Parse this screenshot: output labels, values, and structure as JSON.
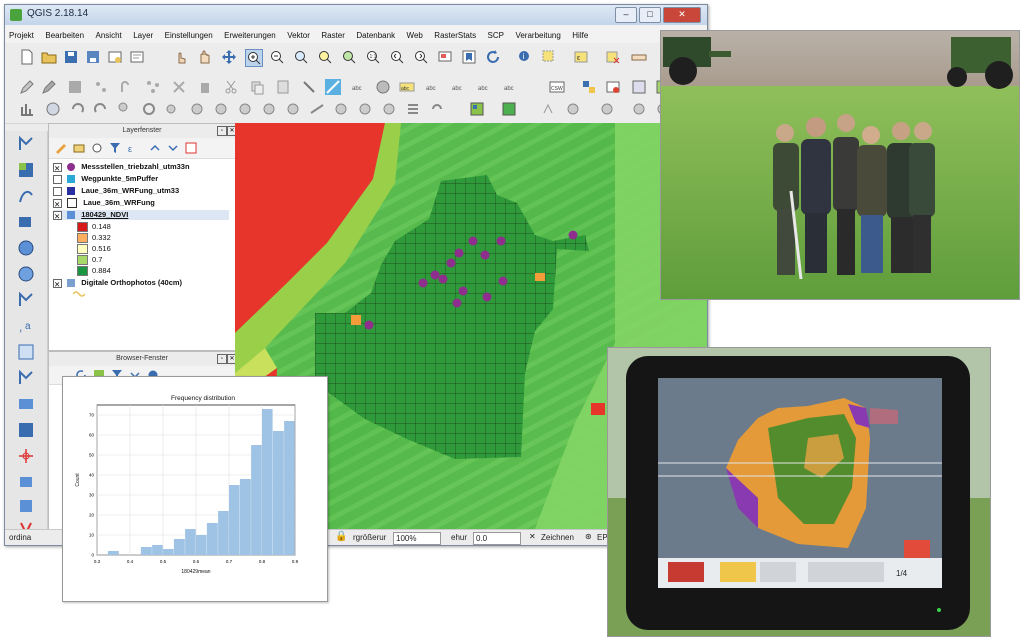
{
  "window": {
    "title": "QGIS 2.18.14",
    "controls": [
      "–",
      "□",
      "✕"
    ]
  },
  "menu": [
    "Projekt",
    "Bearbeiten",
    "Ansicht",
    "Layer",
    "Einstellungen",
    "Erweiterungen",
    "Vektor",
    "Raster",
    "Datenbank",
    "Web",
    "RasterStats",
    "SCP",
    "Verarbeitung",
    "Hilfe"
  ],
  "layers_panel": {
    "title": "Layerfenster",
    "layers": [
      {
        "name": "Messstellen_triebzahl_utm33n",
        "checked": true,
        "symbol_color": "#8e2f8e",
        "symbol": "point"
      },
      {
        "name": "Wegpunkte_5mPuffer",
        "checked": false,
        "symbol_color": "#2aa8d8",
        "symbol": "fill"
      },
      {
        "name": "Laue_36m_WRFung_utm33",
        "checked": false,
        "symbol_color": "#2a2fa0",
        "symbol": "fill"
      },
      {
        "name": "Laue_36m_WRFung",
        "checked": true,
        "symbol_color": "#ffffff",
        "symbol": "grid"
      },
      {
        "name": "180429_NDVI",
        "checked": true,
        "symbol_color": "#5b8fd6",
        "symbol": "raster"
      }
    ],
    "ndvi_classes": [
      {
        "value": "0.148",
        "color": "#d7191c"
      },
      {
        "value": "0.332",
        "color": "#fdae61"
      },
      {
        "value": "0.516",
        "color": "#ffffbf"
      },
      {
        "value": "0.7",
        "color": "#a6d96a"
      },
      {
        "value": "0.884",
        "color": "#1a9641"
      }
    ],
    "extra_layer": {
      "name": "Digitale Orthophotos (40cm)",
      "checked": true
    }
  },
  "browser_panel": {
    "title": "Browser-Fenster"
  },
  "statusbar": {
    "coord_label": "ordina",
    "scale_label": "rgrößerur",
    "scale_value": "100%",
    "rotation_label": "ehur",
    "rotation_value": "0.0",
    "render_label": "Zeichnen",
    "crs_label": "EPSG"
  },
  "chart_data": {
    "type": "bar",
    "title": "Frequency distribution",
    "xlabel": "180429mean",
    "ylabel": "Count",
    "xlim": [
      0.3,
      0.9
    ],
    "ylim": [
      0,
      75
    ],
    "x_ticks": [
      "0.3",
      "0.4",
      "0.5",
      "0.6",
      "0.7",
      "0.8",
      "0.9"
    ],
    "y_ticks": [
      "0",
      "10",
      "20",
      "30",
      "40",
      "50",
      "60",
      "70"
    ],
    "bin_edges": [
      0.3,
      0.333,
      0.367,
      0.4,
      0.433,
      0.467,
      0.5,
      0.533,
      0.567,
      0.6,
      0.633,
      0.667,
      0.7,
      0.733,
      0.767,
      0.8,
      0.833,
      0.867,
      0.9
    ],
    "values": [
      0,
      2,
      0,
      0,
      4,
      5,
      3,
      8,
      13,
      10,
      16,
      22,
      35,
      38,
      55,
      73,
      62,
      67
    ],
    "bar_color": "#9ec3e4"
  },
  "photos": {
    "field": {
      "description_hidden": true
    },
    "terminal": {
      "page_label": "1/4"
    }
  }
}
